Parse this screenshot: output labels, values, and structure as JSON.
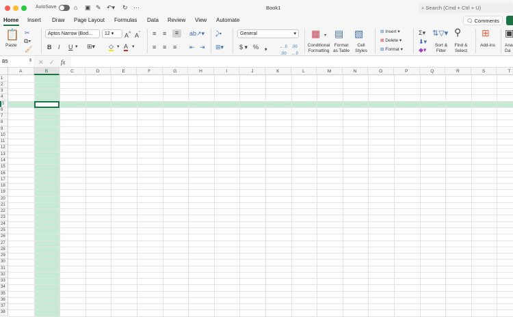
{
  "window": {
    "title": "Book1",
    "autosave_label": "AutoSave",
    "search_placeholder": "Search (Cmd + Ctrl + U)",
    "comments_label": "Comments"
  },
  "tabs": [
    "Home",
    "Insert",
    "Draw",
    "Page Layout",
    "Formulas",
    "Data",
    "Review",
    "View",
    "Automate"
  ],
  "ribbon": {
    "paste": "Paste",
    "font_name": "Aptos Narrow (Bod...",
    "font_size": "12",
    "number_format": "General",
    "bold": "B",
    "italic": "I",
    "underline": "U",
    "currency": "$",
    "percent": "%",
    "comma": "❟",
    "conditional_formatting": [
      "Conditional",
      "Formatting"
    ],
    "format_as_table": [
      "Format",
      "as Table"
    ],
    "cell_styles": [
      "Cell",
      "Styles"
    ],
    "insert": "Insert",
    "delete": "Delete",
    "format": "Format",
    "sort_filter": [
      "Sort &",
      "Filter"
    ],
    "find_select": [
      "Find &",
      "Select"
    ],
    "add_ins": "Add-ins",
    "analyze": [
      "Ana",
      "Da"
    ]
  },
  "formula_bar": {
    "name_box": "B5",
    "fx": "fx",
    "value": ""
  },
  "sheet": {
    "columns": [
      "A",
      "B",
      "C",
      "D",
      "E",
      "F",
      "G",
      "H",
      "I",
      "J",
      "K",
      "L",
      "M",
      "N",
      "O",
      "P",
      "Q",
      "R",
      "S",
      "T"
    ],
    "row_count": 38,
    "selected_cell": "B5",
    "selected_col": "B",
    "selected_row": 5
  },
  "colors": {
    "accent": "#1e7145",
    "selection_fill": "#c6ead4"
  }
}
